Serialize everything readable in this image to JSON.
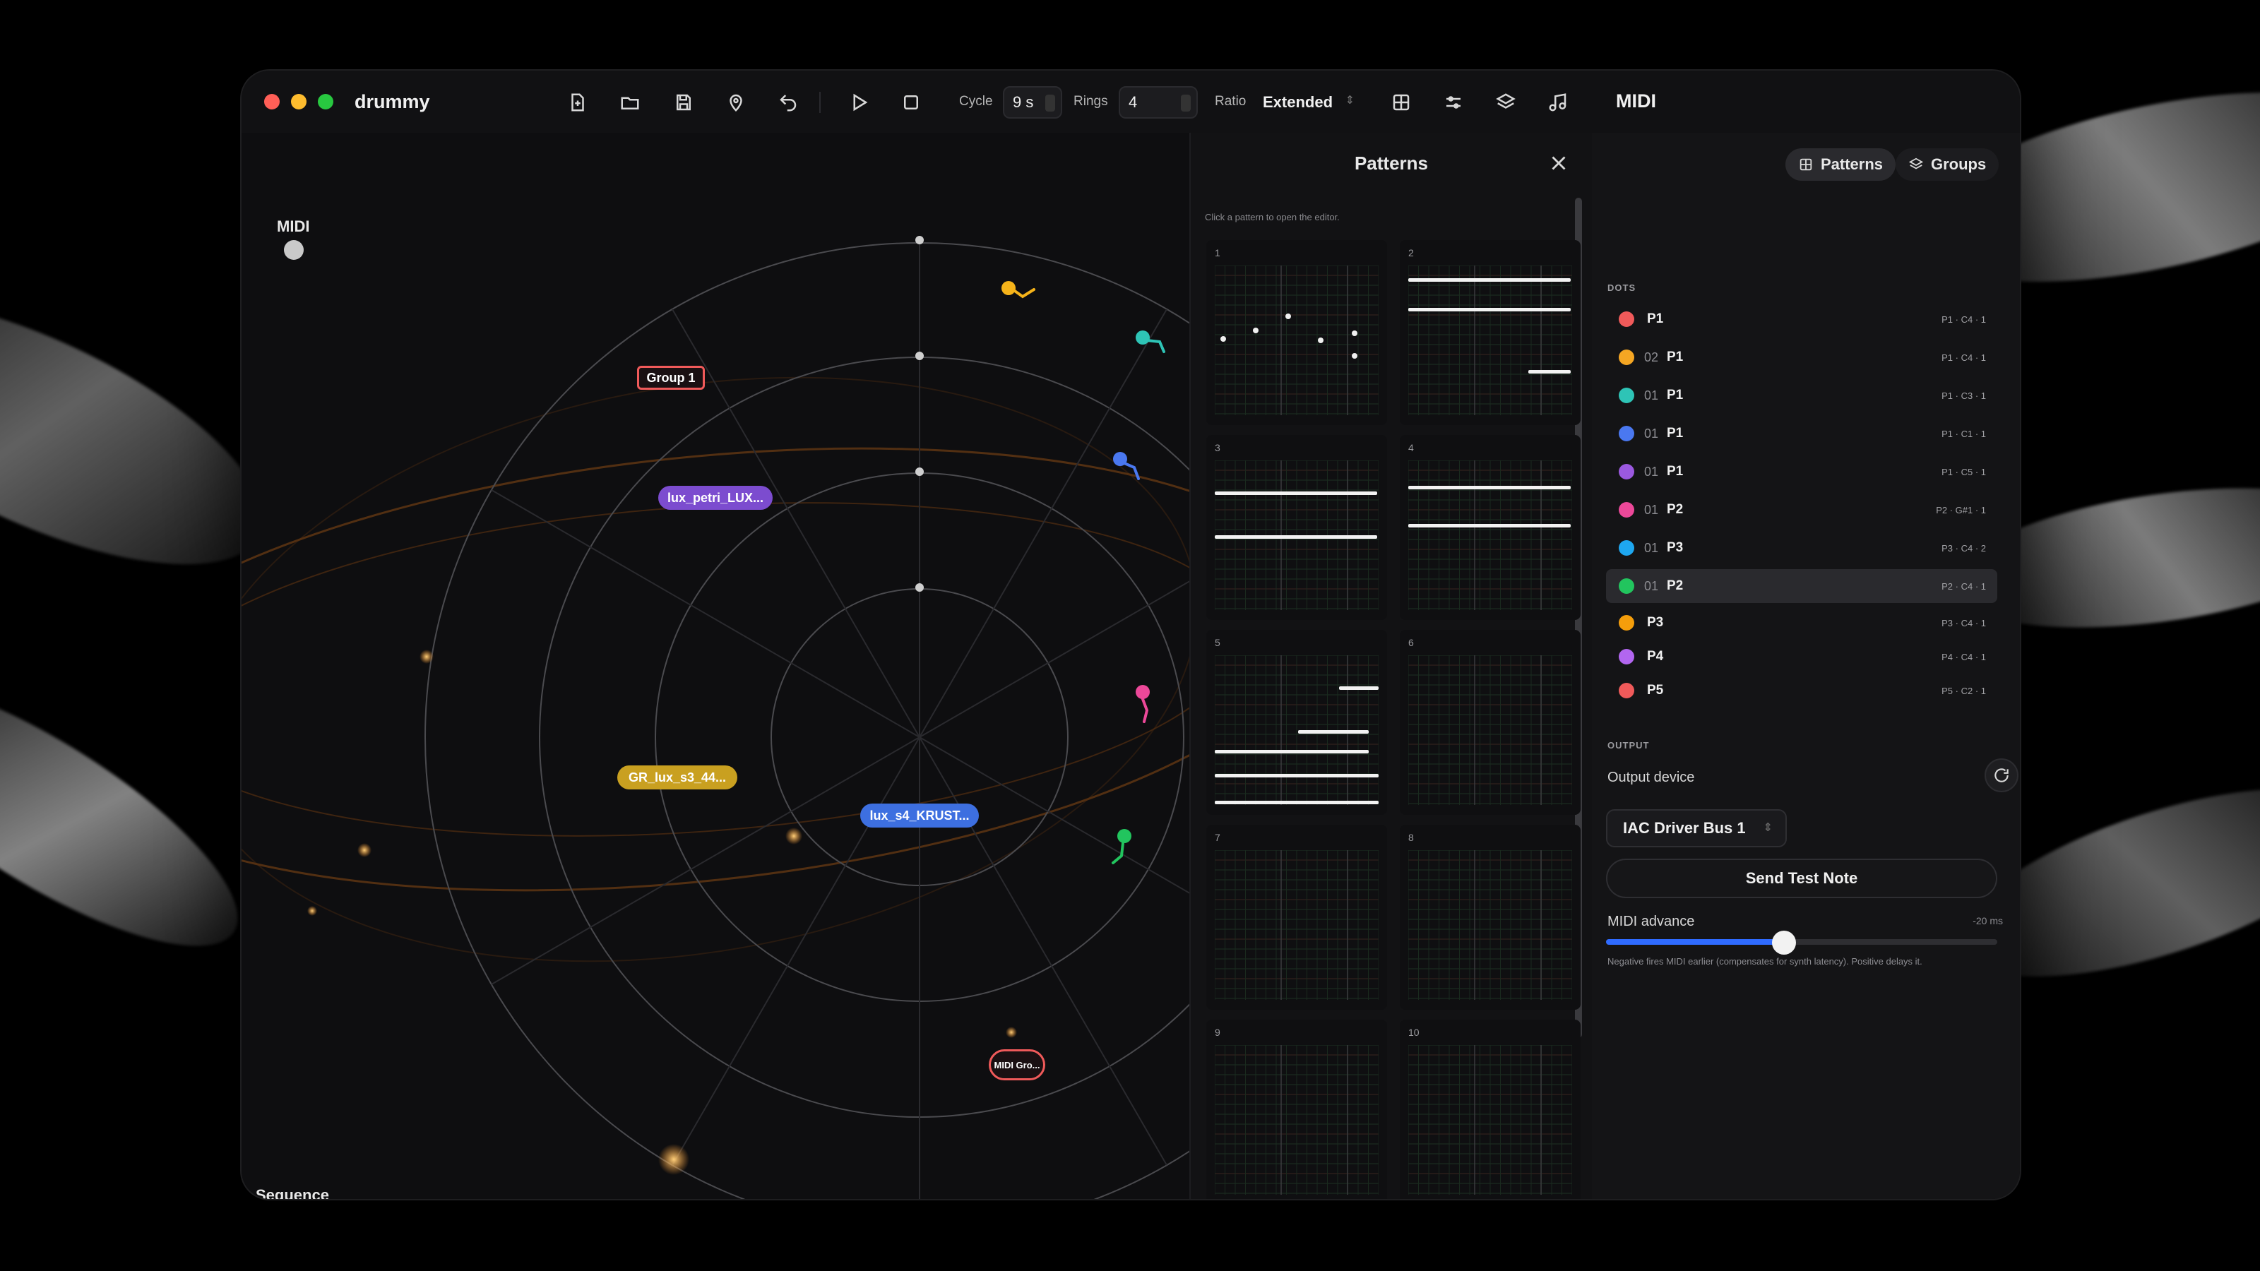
{
  "window": {
    "title": "drummy"
  },
  "toolbar": {
    "cycle_label": "Cycle",
    "cycle_value": "9 s",
    "rings_label": "Rings",
    "rings_value": "4",
    "ratio_label": "Ratio",
    "ratio_value": "Extended"
  },
  "canvas": {
    "midi_label": "MIDI",
    "sequence_label": "Sequence",
    "tags": [
      {
        "label": "Group 1"
      },
      {
        "label": "lux_petri_LUX..."
      },
      {
        "label": "GR_lux_s3_44..."
      },
      {
        "label": "lux_s4_KRUST..."
      },
      {
        "label": "MIDI Gro..."
      }
    ]
  },
  "patterns_panel": {
    "title": "Patterns",
    "hint": "Click a pattern to open the editor.",
    "cards": [
      {
        "num": "1"
      },
      {
        "num": "2"
      },
      {
        "num": "3"
      },
      {
        "num": "4"
      },
      {
        "num": "5"
      },
      {
        "num": "6"
      },
      {
        "num": "7"
      },
      {
        "num": "8"
      },
      {
        "num": "9"
      },
      {
        "num": "10"
      }
    ]
  },
  "midi_panel": {
    "title": "MIDI",
    "tab_patterns": "Patterns",
    "tab_groups": "Groups",
    "dots_label": "DOTS",
    "dots": [
      {
        "color": "#f05a5a",
        "idx": "",
        "name": "P1",
        "meta": "P1 · C4 · 1"
      },
      {
        "color": "#f5a623",
        "idx": "02",
        "name": "P1",
        "meta": "P1 · C4 · 1"
      },
      {
        "color": "#2ec4b6",
        "idx": "01",
        "name": "P1",
        "meta": "P1 · C3 · 1"
      },
      {
        "color": "#4a78f0",
        "idx": "01",
        "name": "P1",
        "meta": "P1 · C1 · 1"
      },
      {
        "color": "#9b59e0",
        "idx": "01",
        "name": "P1",
        "meta": "P1 · C5 · 1"
      },
      {
        "color": "#ec4899",
        "idx": "01",
        "name": "P2",
        "meta": "P2 · G#1 · 1"
      },
      {
        "color": "#1ea7f0",
        "idx": "01",
        "name": "P3",
        "meta": "P3 · C4 · 2"
      },
      {
        "color": "#22c55e",
        "idx": "01",
        "name": "P2",
        "meta": "P2 · C4 · 1"
      },
      {
        "color": "#f59e0b",
        "idx": "",
        "name": "P3",
        "meta": "P3 · C4 · 1"
      },
      {
        "color": "#b266f0",
        "idx": "",
        "name": "P4",
        "meta": "P4 · C4 · 1"
      },
      {
        "color": "#f05a5a",
        "idx": "",
        "name": "P5",
        "meta": "P5 · C2 · 1"
      }
    ],
    "output_label": "OUTPUT",
    "output_device_label": "Output device",
    "output_device_value": "IAC Driver Bus 1",
    "send_test_note": "Send Test Note",
    "midi_advance_label": "MIDI advance",
    "midi_advance_value": "-20 ms",
    "midi_advance_fraction": 0.455,
    "midi_advance_hint": "Negative fires MIDI earlier (compensates for synth latency). Positive delays it."
  }
}
